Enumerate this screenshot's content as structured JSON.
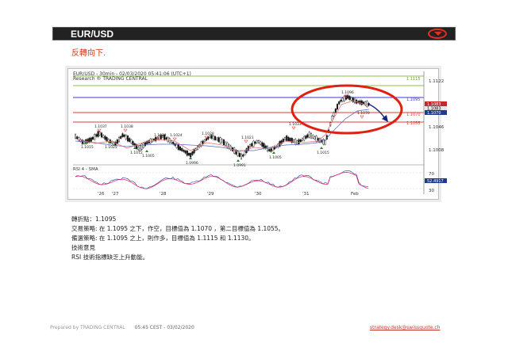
{
  "title": "EUR/USD",
  "subtitle": "反轉向下.",
  "chart": {
    "header_line1": "EUR/USD - 30min - 02/03/2020 05:41:06 (UTC+1)",
    "header_line2": "Research ® TRADING CENTRAL",
    "price_levels": [
      "1.1122",
      "1.1115",
      "1.1095",
      "1.1083",
      "1.1070",
      "1.1065",
      "1.1055",
      "1.1046",
      "1.1008"
    ],
    "swing_labels": [
      "1.1037",
      "1.1038",
      "1.1024",
      "1.1024",
      "1.1028",
      "1.1021",
      "1.1033",
      "1.1096",
      "1.1070",
      "1.1015",
      "1.1023",
      "1.1012",
      "1.1005",
      "1.0996",
      "1.0991",
      "1.1005",
      "1.1015"
    ],
    "date_labels": [
      "'26",
      "'27",
      "'28",
      "'29",
      "'30",
      "'31",
      "Feb"
    ],
    "rsi_label": "RSI 4 - SMA",
    "rsi_levels": [
      "70",
      "52.4917",
      "30"
    ],
    "rsi_value": "52.4917"
  },
  "notes": {
    "pivot": "轉折點：1.1095",
    "strategy": "交易策略: 在 1.1095 之下，作空，目標值為 1.1070 ，第二目標值為 1.1055。",
    "alternative": "備選策略: 在 1.1095 之上，則作多，目標值為 1.1115 和 1.1130。",
    "comment_title": "技術意見",
    "comment": "RSI 技術指標缺乏上升動能。"
  },
  "footer": {
    "prepared_by": "Prepared by TRADING CENTRAL",
    "datetime": "05:45 CEST - 03/02/2020",
    "email": "strategy.desk@swissquote.ch"
  }
}
